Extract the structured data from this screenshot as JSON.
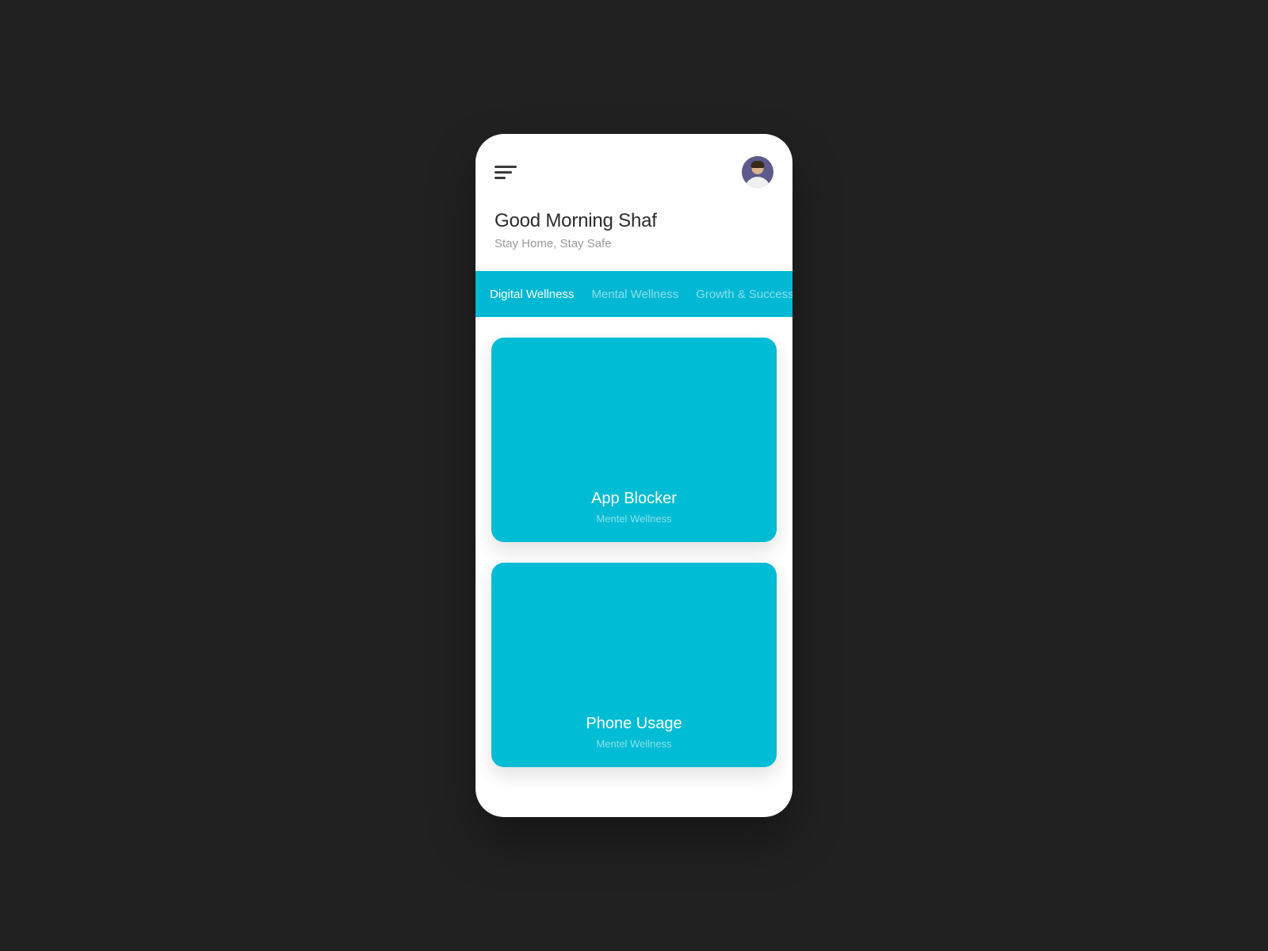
{
  "header": {
    "greeting": "Good Morning Shaf",
    "subtitle": "Stay Home, Stay Safe"
  },
  "tabs": {
    "items": [
      {
        "label": "Digital Wellness",
        "active": true
      },
      {
        "label": "Mental Wellness",
        "active": false
      },
      {
        "label": "Growth & Success",
        "active": false
      }
    ]
  },
  "cards": [
    {
      "title": "App Blocker",
      "subtitle": "Mentel Wellness"
    },
    {
      "title": "Phone Usage",
      "subtitle": "Mentel Wellness"
    }
  ],
  "colors": {
    "tab_bar": "#00b8d4",
    "card": "#00bcd4",
    "background": "#212121"
  }
}
